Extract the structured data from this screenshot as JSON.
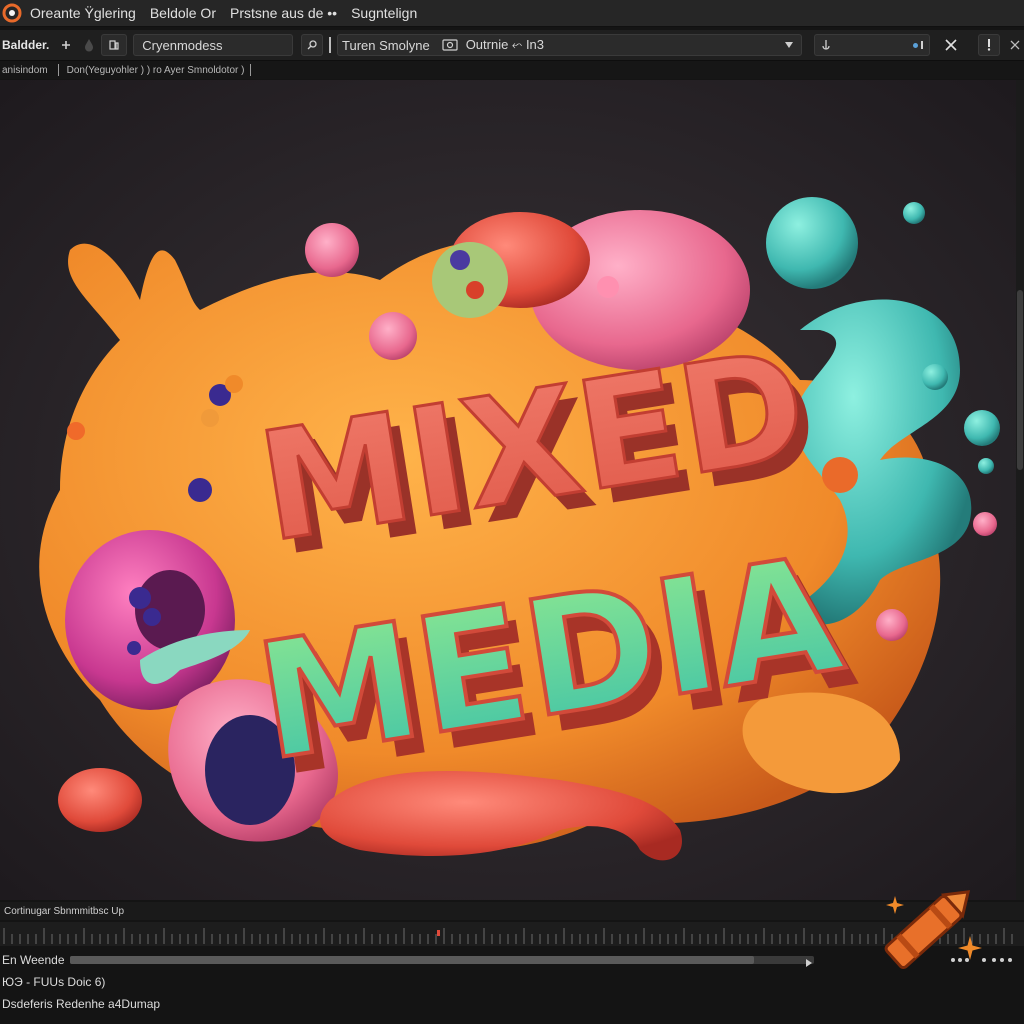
{
  "titlebar": {
    "menu": [
      "Oreante Ÿglering",
      "Beldole Or",
      "Prstsne aus de ••",
      "Sugntelign"
    ]
  },
  "toolbar": {
    "label": "Baldder.",
    "preset_field": "Cryenmodess",
    "name_field": "Turen Smolyne",
    "mode_dropdown": "Outrnie ⬿ In3"
  },
  "subbar": {
    "left_text": "anisindom",
    "mid_text": "Don(Yeguyohler ) ) ro Ayer Smnoldotor )"
  },
  "artwork": {
    "line1": "MIXED",
    "line2": "MEDIA"
  },
  "timeline": {
    "label": "Cortinugar Sbnmmitbsc Up",
    "progress_pct": 92,
    "rows": [
      "En Weende",
      "ЮЭ - FUUs Doic 6)",
      "Dsdeferis Redenhe a4Dumap"
    ]
  },
  "colors": {
    "panel_bg": "#1f1f1f",
    "canvas_bg": "#262226",
    "accent_orange": "#e8702a",
    "blob_orange": "#f08a2a",
    "blob_pink": "#e85a8a",
    "blob_teal": "#3fb8b0",
    "text_red": "#e25c50",
    "text_mint": "#5fd4a6"
  },
  "icons": [
    "app-logo-icon",
    "plus-icon",
    "drop-icon",
    "layers-icon",
    "link-icon",
    "image-icon",
    "chevron-down-icon",
    "anchor-icon",
    "close-icon",
    "alert-icon",
    "more-icon",
    "crayon-icon",
    "sparkle-icon"
  ]
}
